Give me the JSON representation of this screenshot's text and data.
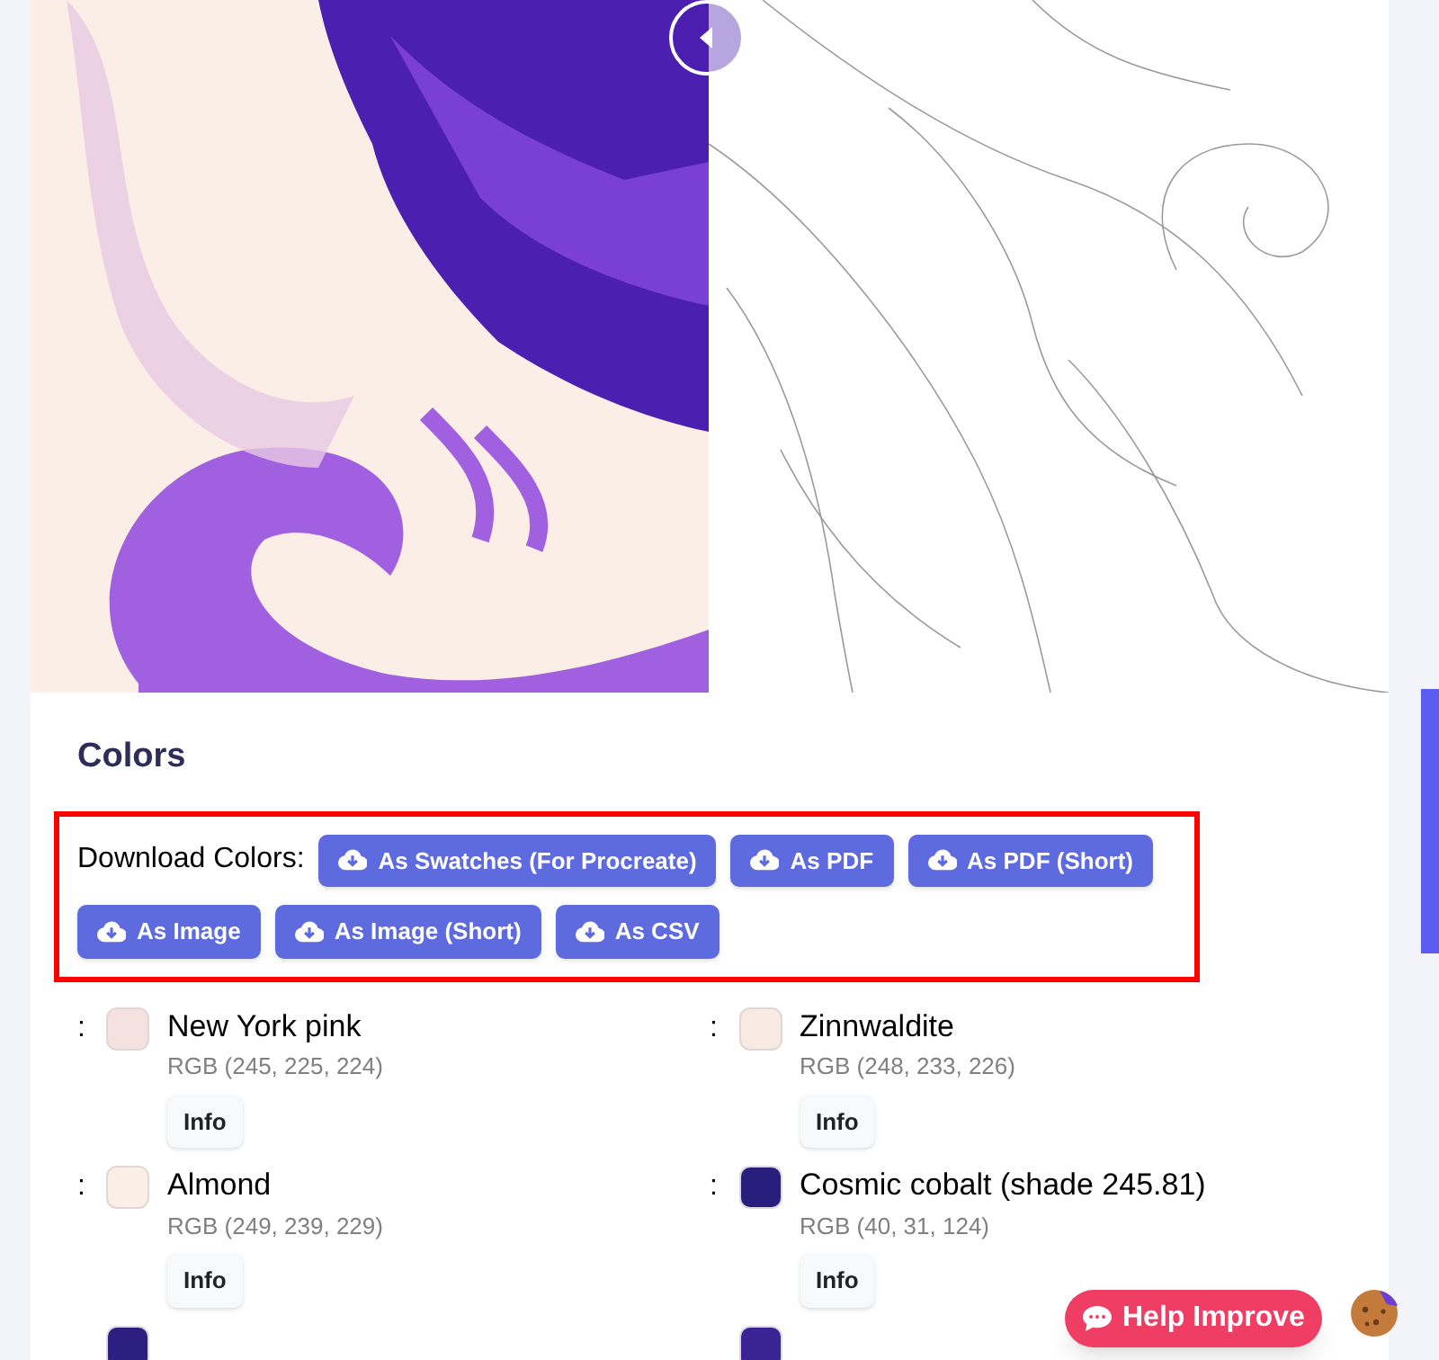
{
  "colors_section": {
    "title": "Colors",
    "download_label": "Download Colors:",
    "download_buttons": [
      "As Swatches (For Procreate)",
      "As PDF",
      "As PDF (Short)",
      "As Image",
      "As Image (Short)",
      "As CSV"
    ],
    "colors": [
      {
        "prefix": ":",
        "name": "New York pink",
        "rgb": "RGB (245, 225, 224)",
        "color": "#f5e1e0",
        "button": "Info"
      },
      {
        "prefix": ":",
        "name": "Zinnwaldite",
        "rgb": "RGB (248, 233, 226)",
        "color": "#f8e9e2",
        "button": "Info"
      },
      {
        "prefix": ":",
        "name": "Almond",
        "rgb": "RGB (249, 239, 229)",
        "color": "#f9efe5",
        "button": "Info"
      },
      {
        "prefix": ":",
        "name": "Cosmic cobalt (shade 245.81)",
        "rgb": "RGB (40, 31, 124)",
        "color": "#281f7c",
        "button": "Info"
      },
      {
        "color": "#2c1f80"
      },
      {
        "color": "#3a2494"
      }
    ]
  },
  "help_button": "Help Improve"
}
